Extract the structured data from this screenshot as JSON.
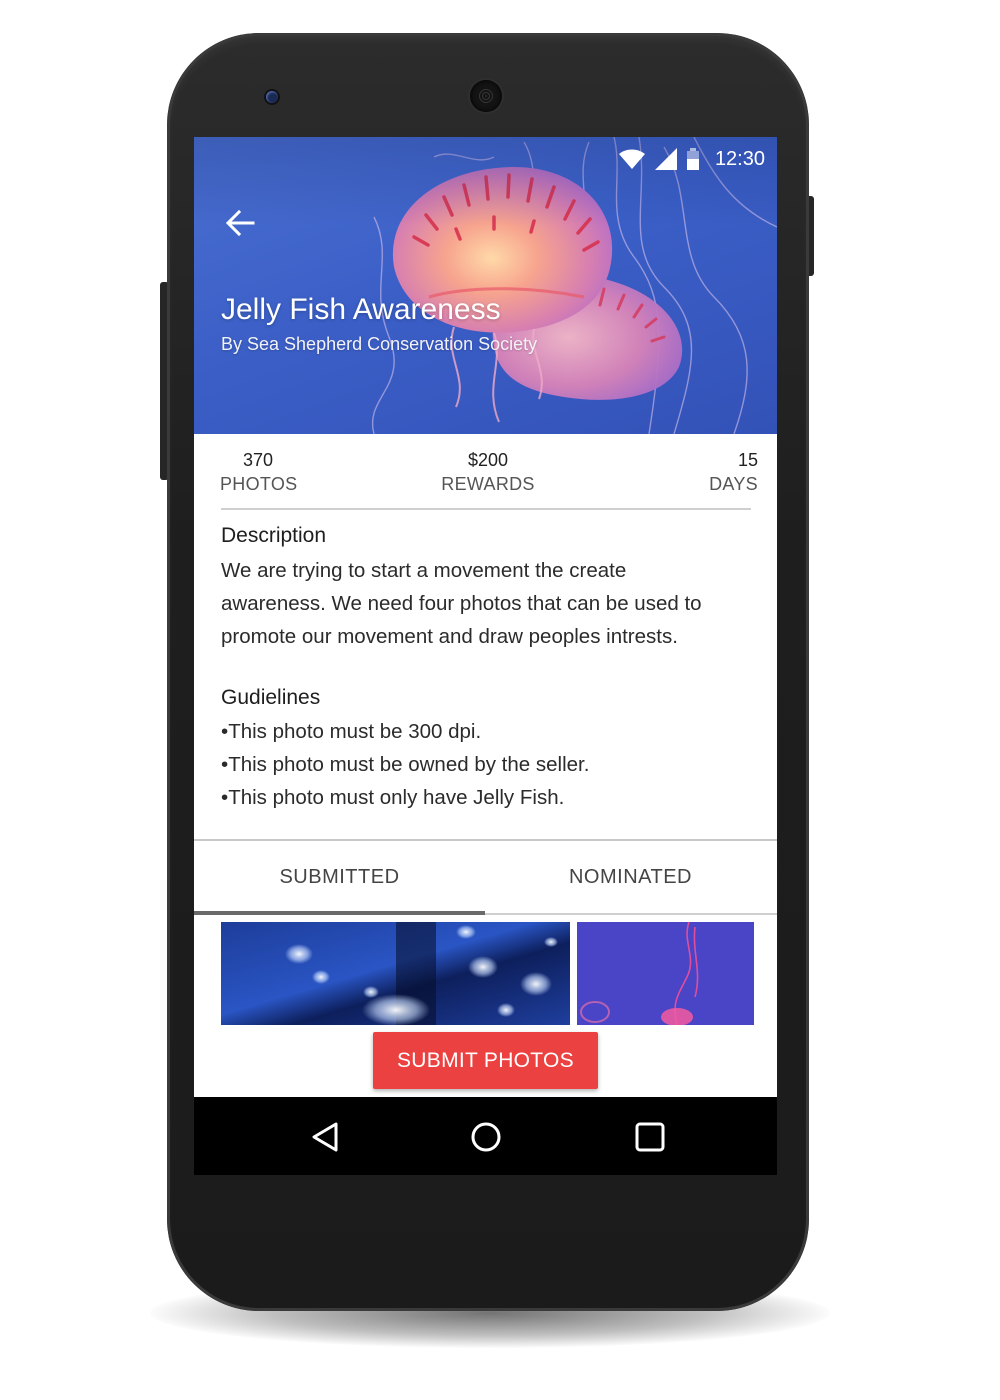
{
  "status_bar": {
    "time": "12:30",
    "icons": [
      "wifi-icon",
      "signal-icon",
      "battery-icon"
    ]
  },
  "header": {
    "back_icon": "arrow-left-icon",
    "title": "Jelly Fish Awareness",
    "subtitle": "By Sea Shepherd Conservation Society"
  },
  "stats": [
    {
      "value": "370",
      "label": "PHOTOS"
    },
    {
      "value": "$200",
      "label": "REWARDS"
    },
    {
      "value": "15",
      "label": "DAYS"
    }
  ],
  "description": {
    "heading": "Description",
    "lines": [
      "We are trying to start a movement the create",
      "awareness. We need four photos that can be used to",
      "promote our movement and draw peoples intrests."
    ]
  },
  "guidelines": {
    "heading": "Gudielines",
    "items": [
      "This photo must be 300 dpi.",
      "This photo must be owned by the seller.",
      "This photo must only have Jelly Fish."
    ]
  },
  "tabs": [
    {
      "label": "SUBMITTED",
      "active": true
    },
    {
      "label": "NOMINATED",
      "active": false
    }
  ],
  "cta": {
    "label": "SUBMIT PHOTOS"
  },
  "nav_bar": {
    "buttons": [
      "back-triangle-icon",
      "home-circle-icon",
      "recents-square-icon"
    ]
  },
  "colors": {
    "hero_blue": "#3b5fc7",
    "cta_red": "#ec4141",
    "phone_body": "#1e1e1e"
  }
}
